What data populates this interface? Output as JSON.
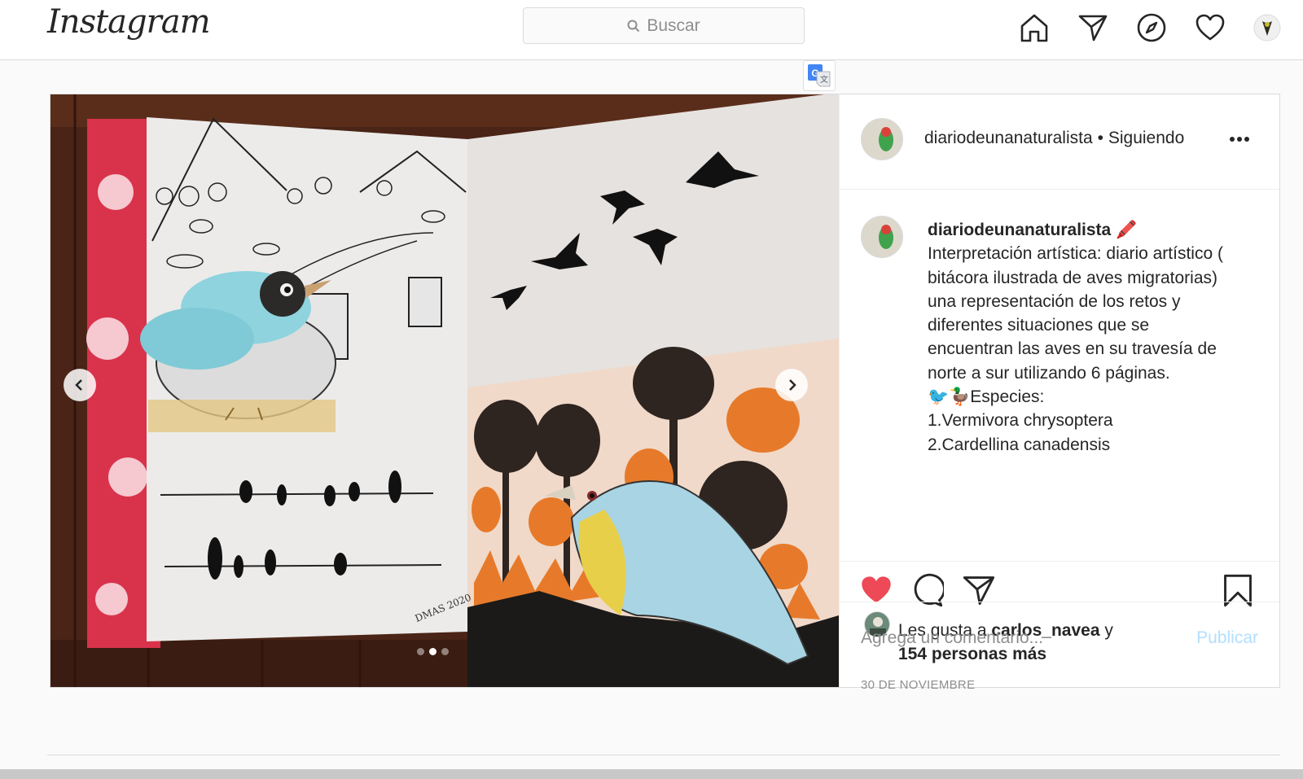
{
  "header": {
    "logo": "Instagram",
    "search_placeholder": "Buscar",
    "nav_icons": [
      "home-icon",
      "direct-icon",
      "explore-icon",
      "activity-icon",
      "profile-avatar"
    ]
  },
  "post": {
    "username": "diariodeunanaturalista",
    "follow_status": "• Siguiendo",
    "caption_username": "diariodeunanaturalista",
    "caption_emoji": "🖍️",
    "caption_lines": [
      "Interpretación artística: diario artístico (",
      "bitácora ilustrada de aves migratorias)",
      "una representación de los retos y",
      "diferentes situaciones que se",
      "encuentran las aves en su travesía de",
      "norte a sur utilizando 6 páginas.",
      "🐦🦆Especies:",
      "1.Vermivora chrysoptera",
      "2.Cardellina canadensis"
    ],
    "likes_prefix": "Les gusta a ",
    "likes_user": "carlos_navea",
    "likes_suffix": " y",
    "likes_others": "154 personas más",
    "date": "30 DE NOVIEMBRE",
    "comment_placeholder": "Agrega un comentario...",
    "publish_label": "Publicar",
    "carousel": {
      "count": 3,
      "active_index": 1
    },
    "liked": true,
    "image_signature": "DMAS 2020"
  },
  "colors": {
    "like_red": "#ed4956",
    "publish_blue": "#b2dffc",
    "border": "#dbdbdb"
  }
}
